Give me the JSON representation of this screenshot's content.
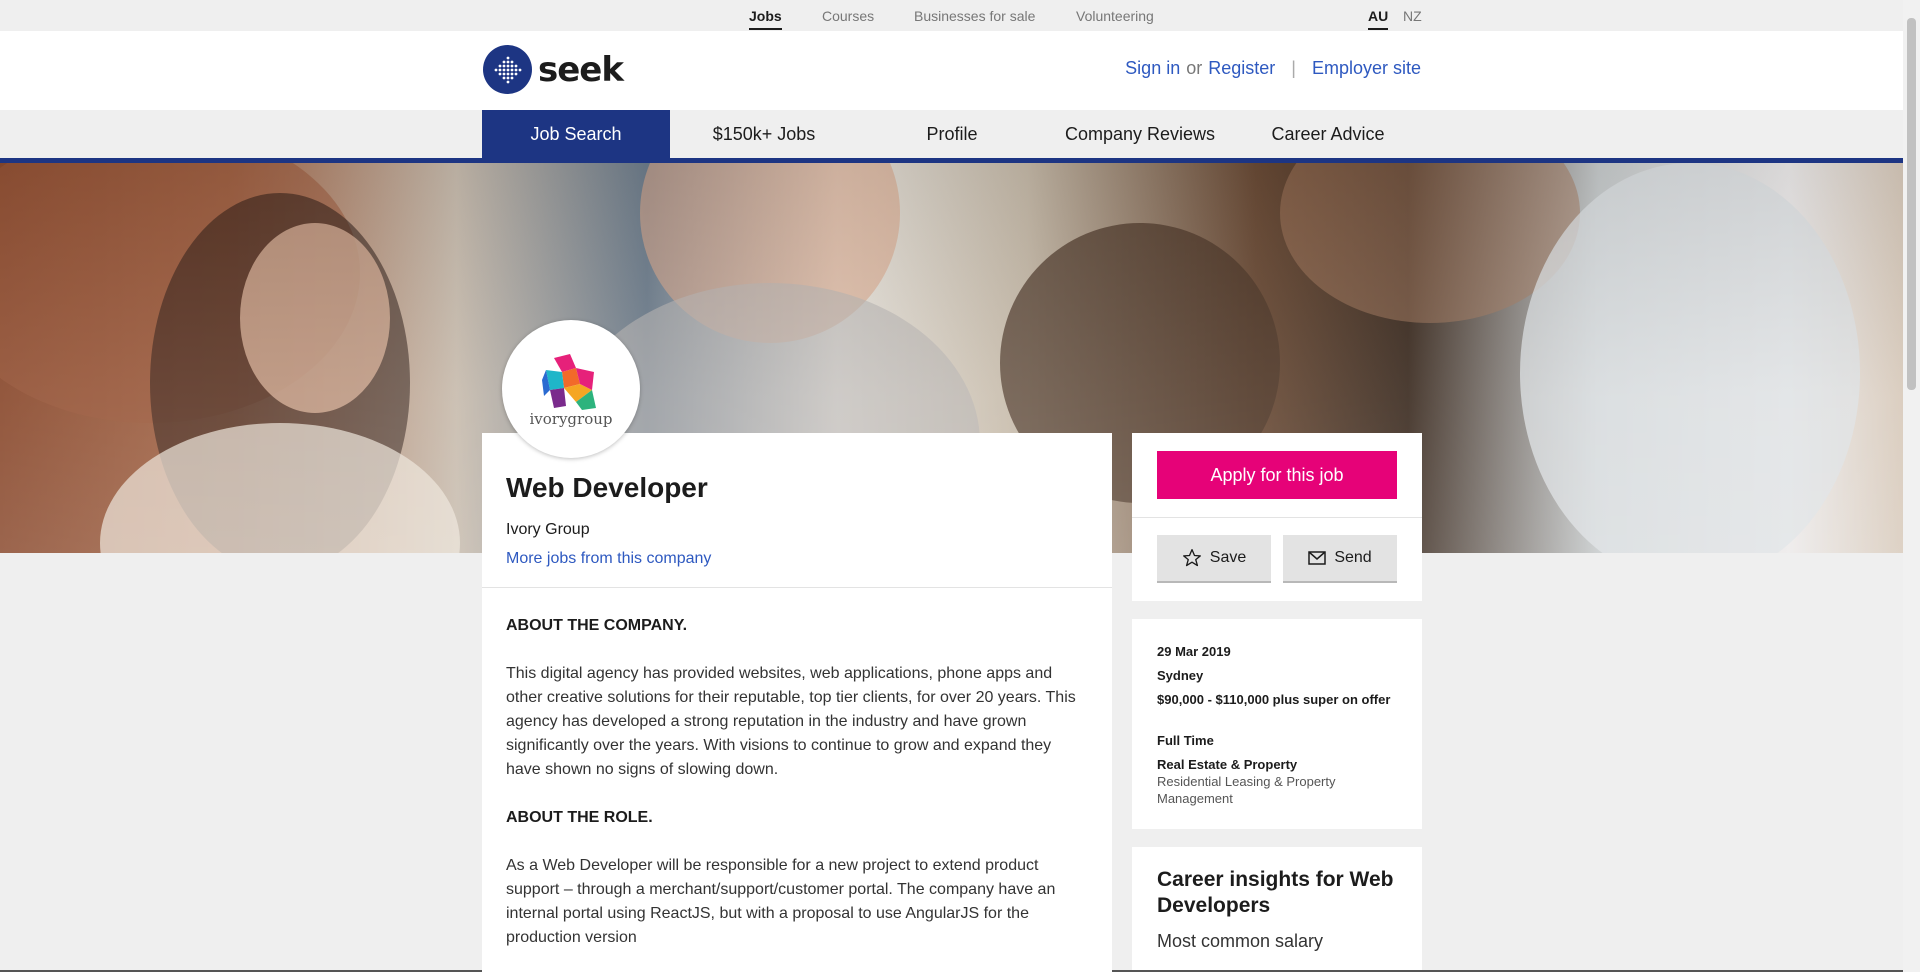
{
  "topbar": {
    "links": [
      "Jobs",
      "Courses",
      "Businesses for sale",
      "Volunteering"
    ],
    "regions": [
      "AU",
      "NZ"
    ]
  },
  "header": {
    "logo_text": "seek",
    "sign_in": "Sign in",
    "or": "or",
    "register": "Register",
    "separator": "|",
    "employer_site": "Employer site"
  },
  "nav": {
    "items": [
      "Job Search",
      "$150k+ Jobs",
      "Profile",
      "Company Reviews",
      "Career Advice"
    ]
  },
  "job": {
    "company_logo_text": "ivorygroup",
    "title": "Web Developer",
    "company": "Ivory Group",
    "more_jobs": "More jobs from this company",
    "about_company_heading": "ABOUT THE COMPANY.",
    "about_company_text": "This digital agency has provided websites, web applications, phone apps and other creative solutions for their reputable, top tier clients, for over 20 years. This agency has developed a strong reputation in the industry and have grown significantly over the years. With visions to continue to grow and expand they have shown no signs of slowing down.",
    "about_role_heading": "ABOUT THE ROLE.",
    "about_role_text": "As a Web Developer will be responsible for a new project to extend product support – through a merchant/support/customer portal. The company have an internal portal using ReactJS, but with a proposal to use AngularJS for the production version"
  },
  "actions": {
    "apply": "Apply for this job",
    "save": "Save",
    "send": "Send"
  },
  "info": {
    "date": "29 Mar 2019",
    "location": "Sydney",
    "salary": "$90,000 - $110,000 plus super on offer",
    "work_type": "Full Time",
    "classification": "Real Estate & Property",
    "subclassification": "Residential Leasing & Property Management"
  },
  "insights": {
    "title": "Career insights for Web Developers",
    "subtitle": "Most common salary"
  },
  "colors": {
    "brand_blue": "#1d3583",
    "link_blue": "#2e59c0",
    "apply_pink": "#e60278"
  }
}
